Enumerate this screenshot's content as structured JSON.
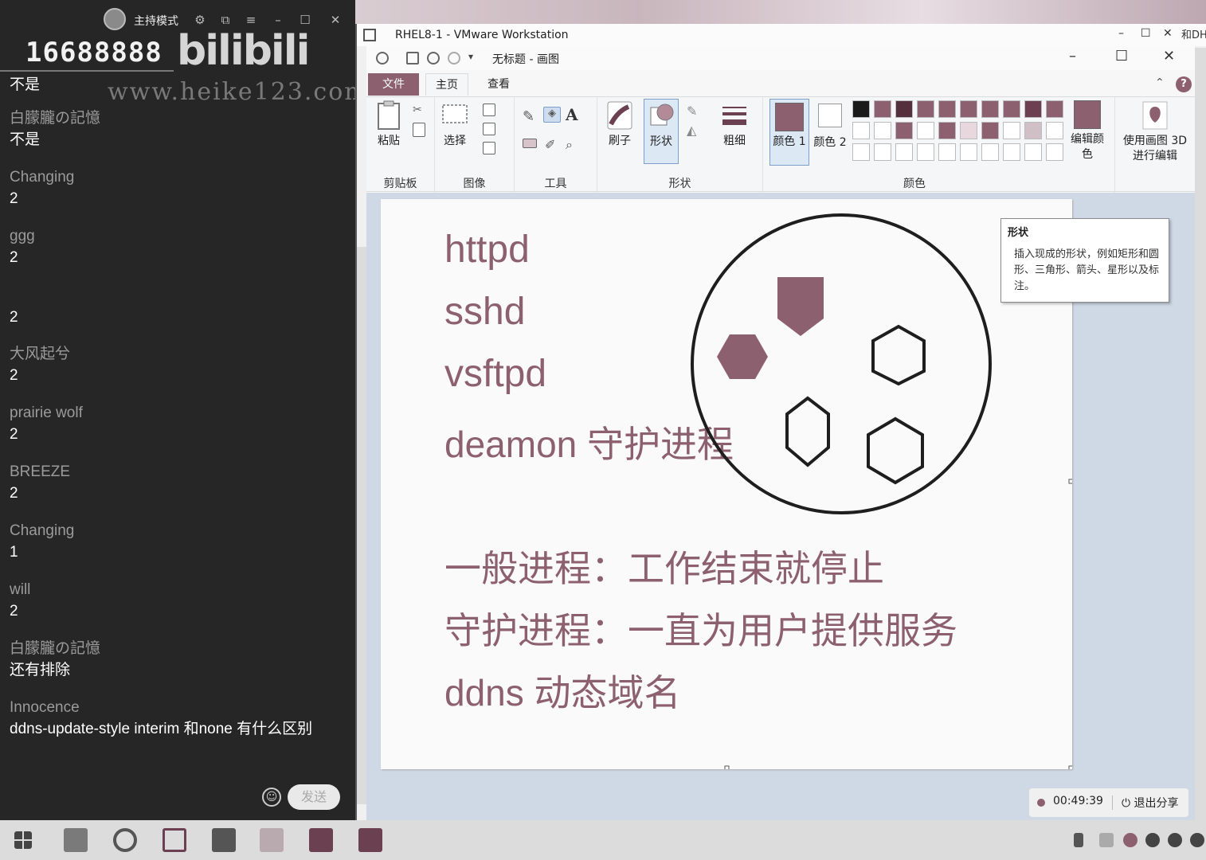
{
  "chat": {
    "host_mode_label": "主持模式",
    "room_id": "16688888",
    "logo_text": "bilibili",
    "watermark_url": "www.heike123.com",
    "messages": [
      {
        "name": "",
        "text": "不是"
      },
      {
        "name": "白朦朧の記憶",
        "text": "不是"
      },
      {
        "name": "Changing",
        "text": "2"
      },
      {
        "name": "ggg",
        "text": "2"
      },
      {
        "name": "",
        "text": "2"
      },
      {
        "name": "大风起兮",
        "text": "2"
      },
      {
        "name": "prairie wolf",
        "text": "2"
      },
      {
        "name": "BREEZE",
        "text": "2"
      },
      {
        "name": "Changing",
        "text": "1"
      },
      {
        "name": "will",
        "text": "2"
      },
      {
        "name": "白朦朧の記憶",
        "text": "还有排除"
      },
      {
        "name": "Innocence",
        "text": "ddns-update-style  interim 和none 有什么区别"
      }
    ],
    "send_label": "发送"
  },
  "vm": {
    "title": "RHEL8-1 - VMware Workstation",
    "extra_label": "和DH"
  },
  "paint": {
    "doc_title": "无标题 - 画图",
    "tabs": {
      "file": "文件",
      "home": "主页",
      "view": "查看"
    },
    "groups": {
      "clipboard": "剪贴板",
      "image": "图像",
      "tools": "工具",
      "shapes": "形状",
      "colors": "颜色"
    },
    "buttons": {
      "paste": "粘贴",
      "select": "选择",
      "brush": "刷子",
      "shapes": "形状",
      "size": "粗细",
      "color1": "颜色 1",
      "color2": "颜色 2",
      "edit_colors": "编辑颜色",
      "paint3d": "使用画图 3D 进行编辑"
    },
    "tooltip": {
      "title": "形状",
      "desc": "插入现成的形状，例如矩形和圆形、三角形、箭头、星形以及标注。"
    },
    "canvas_text": [
      "httpd",
      "sshd",
      "vsftpd",
      "deamon 守护进程",
      "一般进程：工作结束就停止",
      "守护进程：一直为用户提供服务",
      "ddns 动态域名"
    ],
    "accent_color": "#8d6070",
    "palette": [
      "#1a1a1a",
      "#8d6070",
      "#55303c",
      "#8d6070",
      "#8d6070",
      "#8d6070",
      "#8d6070",
      "#8d6070",
      "#6c4050",
      "#8d6070",
      "#ffffff",
      "#ffffff",
      "#8d6070",
      "#ffffff",
      "#8d6070",
      "#e8d8dd",
      "#8d6070",
      "#ffffff",
      "#d0c0c6",
      "#ffffff"
    ]
  },
  "recorder": {
    "time": "00:49:39",
    "exit_label": "退出分享"
  }
}
